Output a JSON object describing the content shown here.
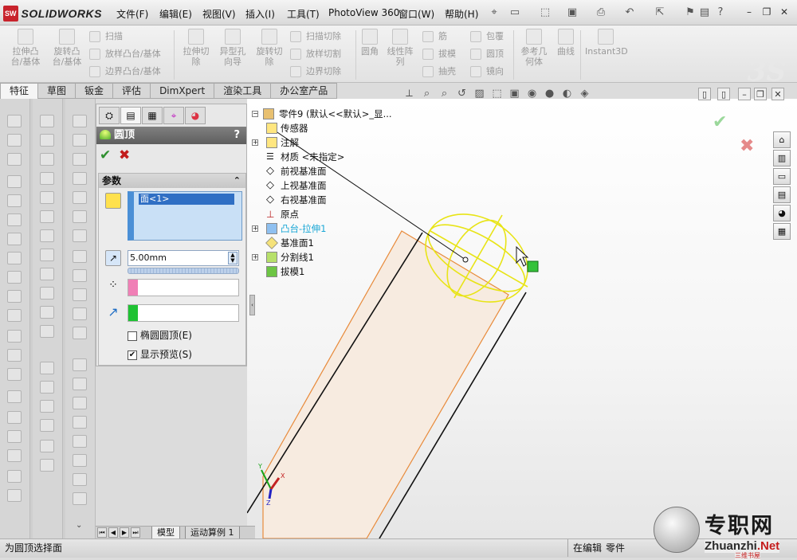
{
  "app": {
    "logo_badge": "SW",
    "logo_text": "SOLIDWORKS"
  },
  "menu": [
    "文件(F)",
    "编辑(E)",
    "视图(V)",
    "插入(I)",
    "工具(T)",
    "PhotoView 360",
    "窗口(W)",
    "帮助(H)"
  ],
  "ribbon": {
    "extrude_boss": "拉伸凸\n台/基体",
    "revolve_boss": "旋转凸\n台/基体",
    "sweep": "扫描",
    "loft_boss": "放样凸台/基体",
    "boundary_boss": "边界凸台/基体",
    "extrude_cut": "拉伸切\n除",
    "hole_wizard": "异型孔\n向导",
    "revolve_cut": "旋转切\n除",
    "swept_cut": "扫描切除",
    "lofted_cut": "放样切割",
    "boundary_cut": "边界切除",
    "fillet": "圆角",
    "linear_pattern": "线性阵\n列",
    "rib": "筋",
    "draft": "拔模",
    "shell": "抽壳",
    "wrap": "包覆",
    "dome": "圆顶",
    "mirror": "镜向",
    "ref_geometry": "参考几\n何体",
    "curves": "曲线",
    "instant3d": "Instant3D"
  },
  "tabs": [
    "特征",
    "草图",
    "钣金",
    "评估",
    "DimXpert",
    "渲染工具",
    "办公室产品"
  ],
  "property_manager": {
    "title": "圆顶",
    "help": "?",
    "ok": "✔",
    "cancel": "✖",
    "group_title": "参数",
    "collapse": "⌃",
    "face_item": "面<1>",
    "distance": "5.00mm",
    "elliptical_label": "椭圆圆顶(E)",
    "elliptical_checked": false,
    "preview_label": "显示预览(S)",
    "preview_checked": true,
    "colors": {
      "face_box": "#4a8fd6",
      "point_swatch": "#f07fb6",
      "direction_swatch": "#1fc233"
    }
  },
  "feature_tree": [
    {
      "label": "零件9  (默认<<默认>_显...",
      "icon": "part-icon",
      "expand": "minus"
    },
    {
      "label": "传感器",
      "icon": "sensor-icon"
    },
    {
      "label": "注解",
      "icon": "annotation-icon",
      "expand": "plus"
    },
    {
      "label": "材质 <未指定>",
      "icon": "material-icon"
    },
    {
      "label": "前视基准面",
      "icon": "plane-icon"
    },
    {
      "label": "上视基准面",
      "icon": "plane-icon"
    },
    {
      "label": "右视基准面",
      "icon": "plane-icon"
    },
    {
      "label": "原点",
      "icon": "origin-icon"
    },
    {
      "label": "凸台-拉伸1",
      "icon": "extrude-icon",
      "expand": "plus",
      "highlight": true
    },
    {
      "label": "基准面1",
      "icon": "plane-icon"
    },
    {
      "label": "分割线1",
      "icon": "split-line-icon",
      "expand": "plus"
    },
    {
      "label": "拔模1",
      "icon": "draft-icon"
    }
  ],
  "triad": {
    "x": "X",
    "y": "Y",
    "z": "Z"
  },
  "bottom_tabs": [
    "模型",
    "运动算例 1"
  ],
  "status": {
    "message": "为圆顶选择面",
    "mode": "在编辑",
    "doc_type": "零件"
  },
  "watermark": {
    "cn": "专职网",
    "url_a": "Zhuanzhi",
    "url_b": ".Net",
    "sub": "三维书屋"
  }
}
